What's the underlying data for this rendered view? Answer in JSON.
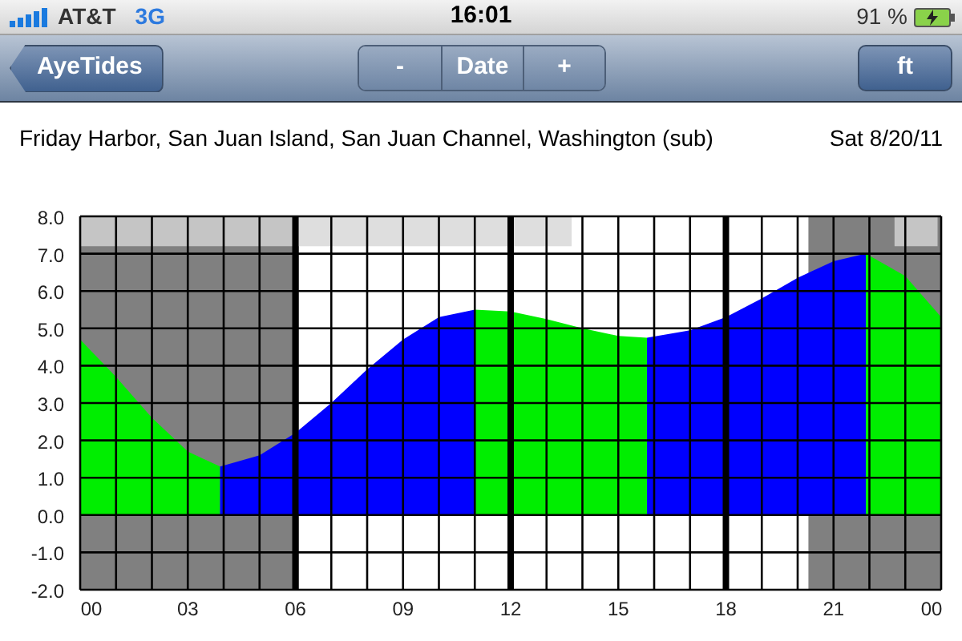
{
  "status_bar": {
    "carrier": "AT&T",
    "network": "3G",
    "time": "16:01",
    "battery": "91 %"
  },
  "nav_bar": {
    "back_button": "AyeTides",
    "segments": [
      "-",
      "Date",
      "+"
    ],
    "unit_button": "ft"
  },
  "location": "Friday Harbor, San Juan Island, San Juan Channel, Washington (sub)",
  "date": "Sat 8/20/11",
  "chart_data": {
    "type": "area",
    "grid": true,
    "x": [
      0,
      1,
      2,
      3,
      3.9,
      5,
      6,
      7,
      8,
      9,
      10,
      11,
      12,
      13,
      14,
      15,
      15.8,
      17,
      18,
      19,
      20,
      21,
      21.9,
      23,
      24
    ],
    "series": [
      {
        "color": "#00ee00",
        "values": [
          4.7,
          3.7,
          2.6,
          1.7,
          1.3,
          null,
          null,
          null,
          null,
          null,
          null,
          5.5,
          5.45,
          5.25,
          5.0,
          4.8,
          4.75,
          null,
          null,
          null,
          null,
          null,
          7.0,
          6.4,
          5.3
        ]
      },
      {
        "color": "#0000ff",
        "values": [
          null,
          null,
          null,
          null,
          1.3,
          1.6,
          2.2,
          3.0,
          3.9,
          4.7,
          5.3,
          5.5,
          null,
          null,
          null,
          null,
          4.75,
          4.95,
          5.3,
          5.8,
          6.35,
          6.8,
          7.0,
          null,
          null
        ]
      }
    ],
    "xlim": [
      0,
      24
    ],
    "ylim": [
      -2,
      8
    ],
    "xticks": [
      {
        "value": 0,
        "label": "00"
      },
      {
        "value": 3,
        "label": "03"
      },
      {
        "value": 6,
        "label": "06"
      },
      {
        "value": 9,
        "label": "09"
      },
      {
        "value": 12,
        "label": "12"
      },
      {
        "value": 15,
        "label": "15"
      },
      {
        "value": 18,
        "label": "18"
      },
      {
        "value": 21,
        "label": "21"
      },
      {
        "value": 24,
        "label": "00"
      }
    ],
    "yticks": [
      {
        "value": 8,
        "label": "8.0"
      },
      {
        "value": 7,
        "label": "7.0"
      },
      {
        "value": 6,
        "label": "6.0"
      },
      {
        "value": 5,
        "label": "5.0"
      },
      {
        "value": 4,
        "label": "4.0"
      },
      {
        "value": 3,
        "label": "3.0"
      },
      {
        "value": 2,
        "label": "2.0"
      },
      {
        "value": 1,
        "label": "1.0"
      },
      {
        "value": 0,
        "label": "0.0"
      },
      {
        "value": -1,
        "label": "-1.0"
      },
      {
        "value": -2,
        "label": "-2.0"
      }
    ],
    "bands": [
      {
        "axis": "x",
        "from": 0,
        "to": 6.1,
        "color": "#808080"
      },
      {
        "axis": "x",
        "from": 20.3,
        "to": 24,
        "color": "#808080"
      },
      {
        "axis": "x",
        "from": 0,
        "to": 13.7,
        "color": "#d6d6d6"
      },
      {
        "axis": "x",
        "from": 22.7,
        "to": 23.9,
        "color": "#d6d6d6"
      }
    ]
  }
}
